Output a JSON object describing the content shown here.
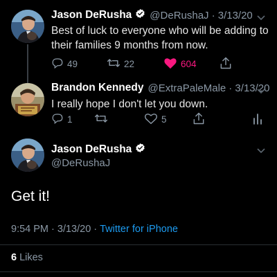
{
  "tweets": [
    {
      "name": "Jason DeRusha",
      "handle": "@DeRushaJ",
      "date": "· 3/13/20",
      "line1": "Best of luck to everyone who will be adding to",
      "line2": "their families 9 months from now.",
      "replies": "49",
      "retweets": "22",
      "likes": "604",
      "liked": true
    },
    {
      "name": "Brandon Kennedy",
      "handle": "@ExtraPaleMale",
      "date": "· 3/13/20",
      "line1": "I really hope I don't let you down.",
      "replies": "1",
      "retweets": "",
      "likes": "5"
    }
  ],
  "main": {
    "name": "Jason DeRusha",
    "handle": "@DeRushaJ",
    "text": "Get it!",
    "time": "9:54 PM · 3/13/20 ·",
    "source": "Twitter for iPhone",
    "like_count": "6",
    "like_label": "Likes"
  },
  "colors": {
    "accent": "#1d9bf0",
    "like": "#f91880",
    "muted": "#8b98a5"
  },
  "icons": [
    "verified-badge-icon",
    "chevron-down-icon",
    "reply-icon",
    "retweet-icon",
    "heart-icon",
    "share-icon",
    "analytics-icon"
  ]
}
